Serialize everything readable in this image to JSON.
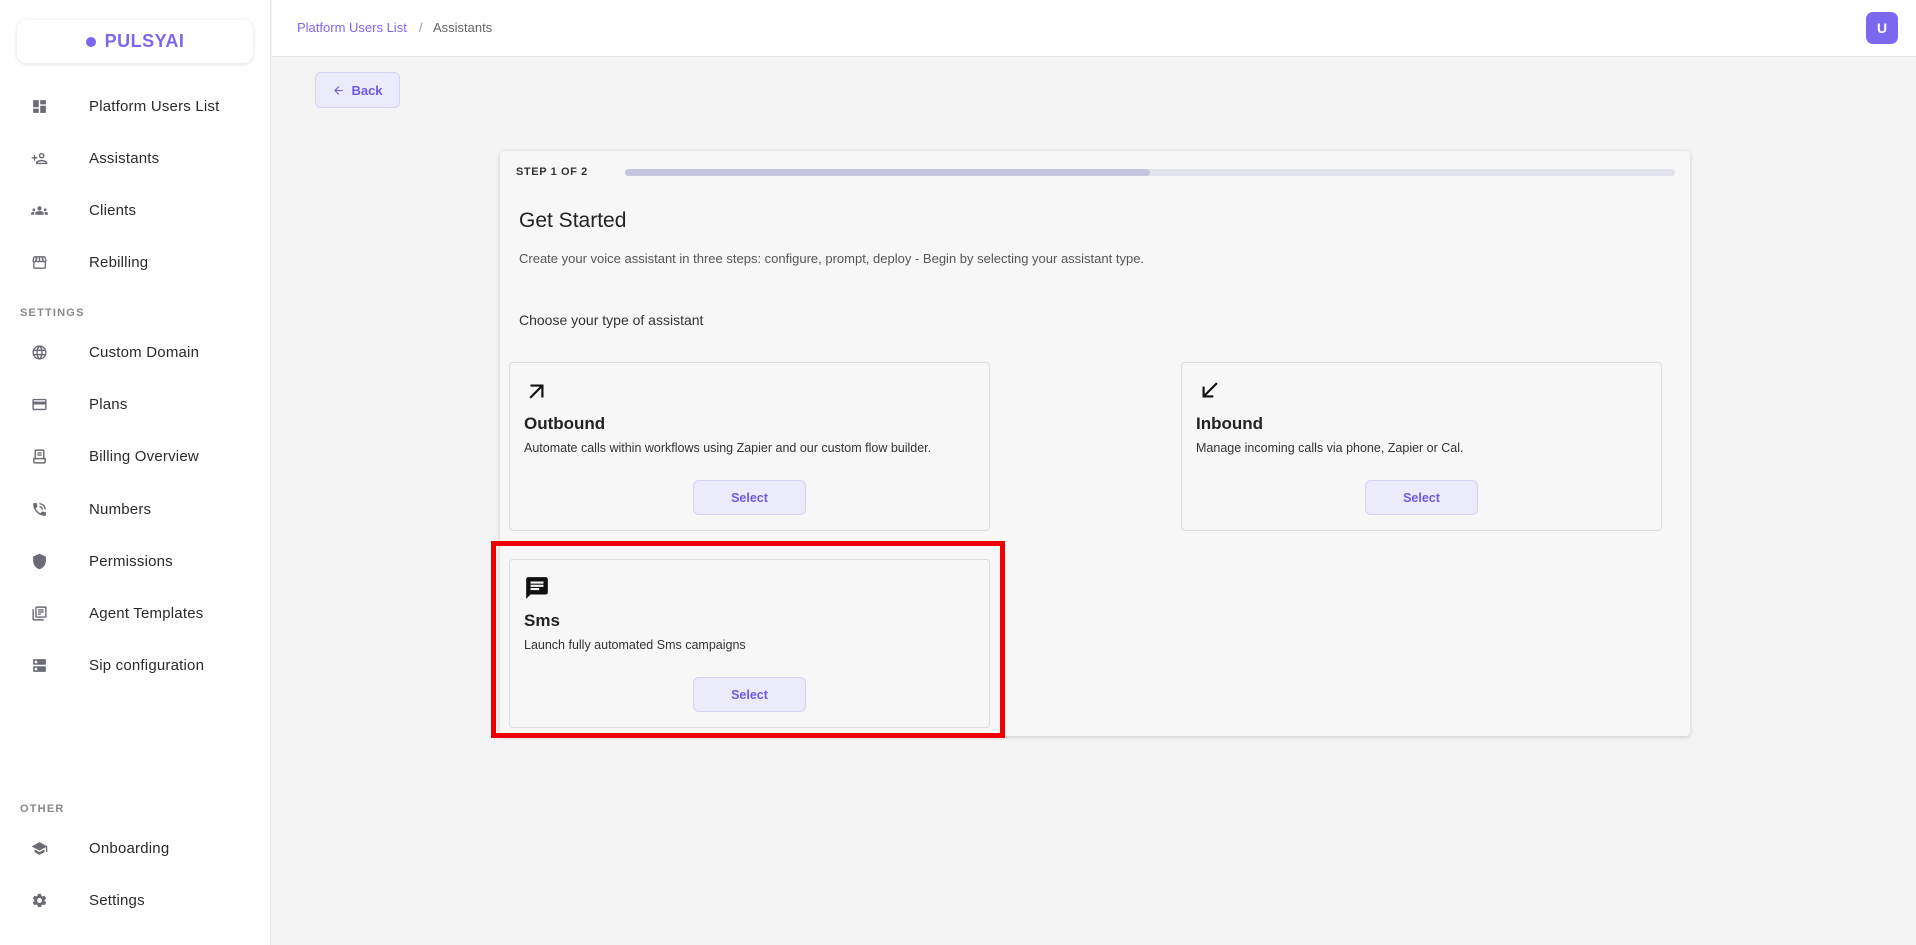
{
  "logo": {
    "text": "PULSYAI"
  },
  "sidebar": {
    "items": [
      {
        "label": "Platform Users List",
        "icon": "dashboard-icon"
      },
      {
        "label": "Assistants",
        "icon": "person-add-icon"
      },
      {
        "label": "Clients",
        "icon": "groups-icon"
      },
      {
        "label": "Rebilling",
        "icon": "store-icon"
      }
    ],
    "settings_label": "SETTINGS",
    "settings_items": [
      {
        "label": "Custom Domain",
        "icon": "globe-icon"
      },
      {
        "label": "Plans",
        "icon": "credit-card-icon"
      },
      {
        "label": "Billing Overview",
        "icon": "receipt-icon"
      },
      {
        "label": "Numbers",
        "icon": "phone-icon"
      },
      {
        "label": "Permissions",
        "icon": "shield-icon"
      },
      {
        "label": "Agent Templates",
        "icon": "library-icon"
      },
      {
        "label": "Sip configuration",
        "icon": "server-icon"
      }
    ],
    "other_label": "OTHER",
    "other_items": [
      {
        "label": "Onboarding",
        "icon": "school-icon"
      },
      {
        "label": "Settings",
        "icon": "gear-icon"
      }
    ]
  },
  "breadcrumb": {
    "link": "Platform Users List",
    "separator": "/",
    "current": "Assistants"
  },
  "user": {
    "initial": "U"
  },
  "back": {
    "label": "Back"
  },
  "wizard": {
    "step": "STEP 1 OF 2",
    "progress": 0.5,
    "title": "Get Started",
    "description": "Create your voice assistant in three steps: configure, prompt, deploy - Begin by selecting your assistant type.",
    "choose_label": "Choose your type of assistant",
    "options": [
      {
        "title": "Outbound",
        "description": "Automate calls within workflows using Zapier and our custom flow builder.",
        "button": "Select",
        "icon": "arrow-outward-icon"
      },
      {
        "title": "Inbound",
        "description": "Manage incoming calls via phone, Zapier or Cal.",
        "button": "Select",
        "icon": "arrow-inward-icon"
      },
      {
        "title": "Sms",
        "description": "Launch fully automated Sms campaigns",
        "button": "Select",
        "icon": "chat-icon"
      }
    ]
  },
  "colors": {
    "accent": "#7b68ee",
    "highlight": "#ee0000"
  }
}
